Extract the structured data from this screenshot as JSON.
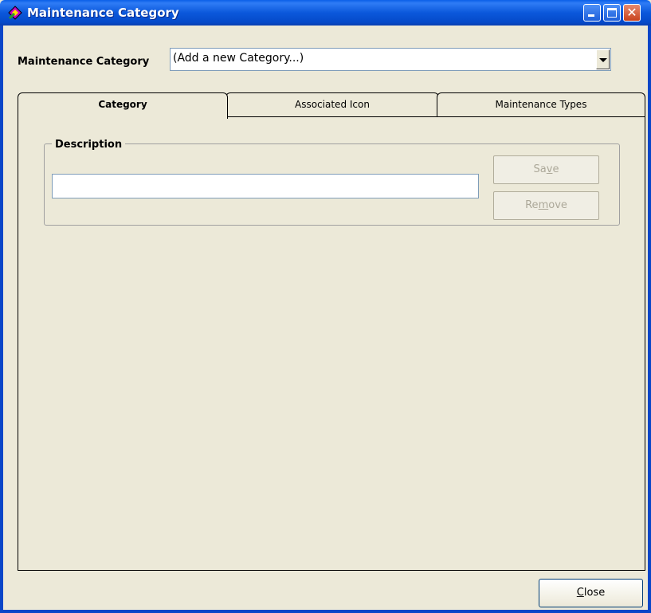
{
  "window": {
    "title": "Maintenance Category"
  },
  "header": {
    "label": "Maintenance Category",
    "combo_value": "(Add a new Category...)"
  },
  "tabs": [
    {
      "label": "Category",
      "active": true
    },
    {
      "label": "Associated Icon",
      "active": false
    },
    {
      "label": "Maintenance Types",
      "active": false
    }
  ],
  "category_panel": {
    "group_title": "Description",
    "description_value": "",
    "save_label_pre": "Sa",
    "save_label_mn": "v",
    "save_label_post": "e",
    "remove_label_pre": "Re",
    "remove_label_mn": "m",
    "remove_label_post": "ove"
  },
  "footer": {
    "close_label_mn": "C",
    "close_label_post": "lose"
  },
  "icons": {
    "app_icon": "wrench-icon",
    "minimize": "minimize-icon",
    "maximize": "maximize-icon",
    "close": "close-icon",
    "dropdown": "chevron-down-icon"
  },
  "colors": {
    "titlebar": "#0A5FE8",
    "window_bg": "#ECE9D8",
    "close_button": "#C8421D"
  }
}
